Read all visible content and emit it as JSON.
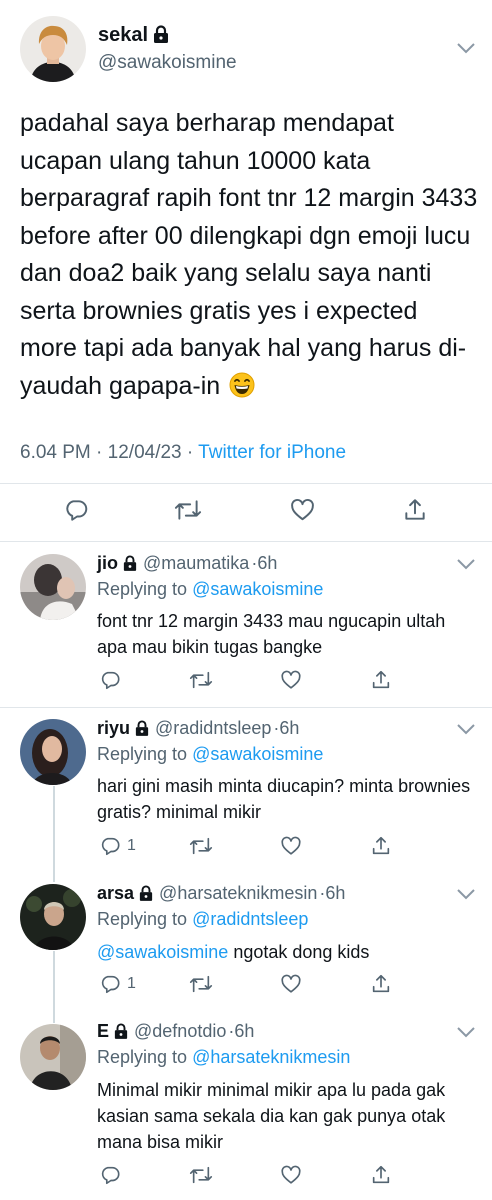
{
  "colors": {
    "text": "#0f1419",
    "muted": "#536471",
    "link": "#1d9bf0",
    "divider": "#e1e6ea"
  },
  "main_tweet": {
    "display_name": "sekal",
    "handle": "@sawakoismine",
    "text": "padahal saya berharap mendapat ucapan ulang tahun 10000 kata berparagraf rapih font tnr 12 margin 3433 before after 00 dilengkapi dgn emoji lucu dan doa2 baik yang selalu saya nanti serta brownies gratis yes i expected more tapi ada banyak hal yang harus di-yaudah gapapa-in",
    "emoji": "grinning-face-with-smiling-eyes",
    "time": "6.04 PM",
    "date": "12/04/23",
    "separator": "·",
    "source": "Twitter for iPhone"
  },
  "replies": [
    {
      "display_name": "jio",
      "handle": "@maumatika",
      "time": "6h",
      "replying_label": "Replying to",
      "replying_to": "@sawakoismine",
      "mention": "",
      "text": "font tnr 12 margin 3433 mau ngucapin ultah apa mau bikin tugas bangke",
      "reply_count": ""
    },
    {
      "display_name": "riyu",
      "handle": "@radidntsleep",
      "time": "6h",
      "replying_label": "Replying to",
      "replying_to": "@sawakoismine",
      "mention": "",
      "text": "hari gini masih minta diucapin? minta brownies gratis? minimal mikir",
      "reply_count": "1"
    },
    {
      "display_name": "arsa",
      "handle": "@harsateknikmesin",
      "time": "6h",
      "replying_label": "Replying to",
      "replying_to": "@radidntsleep",
      "mention": "@sawakoismine",
      "text": " ngotak dong kids",
      "reply_count": "1"
    },
    {
      "display_name": "E",
      "handle": "@defnotdio",
      "time": "6h",
      "replying_label": "Replying to",
      "replying_to": "@harsateknikmesin",
      "mention": "",
      "text": "Minimal mikir minimal mikir apa lu pada gak kasian sama sekala dia kan gak punya otak mana bisa mikir",
      "reply_count": ""
    }
  ],
  "icons": [
    "reply-icon",
    "retweet-icon",
    "like-icon",
    "share-icon",
    "lock-icon",
    "chevron-down-icon"
  ]
}
